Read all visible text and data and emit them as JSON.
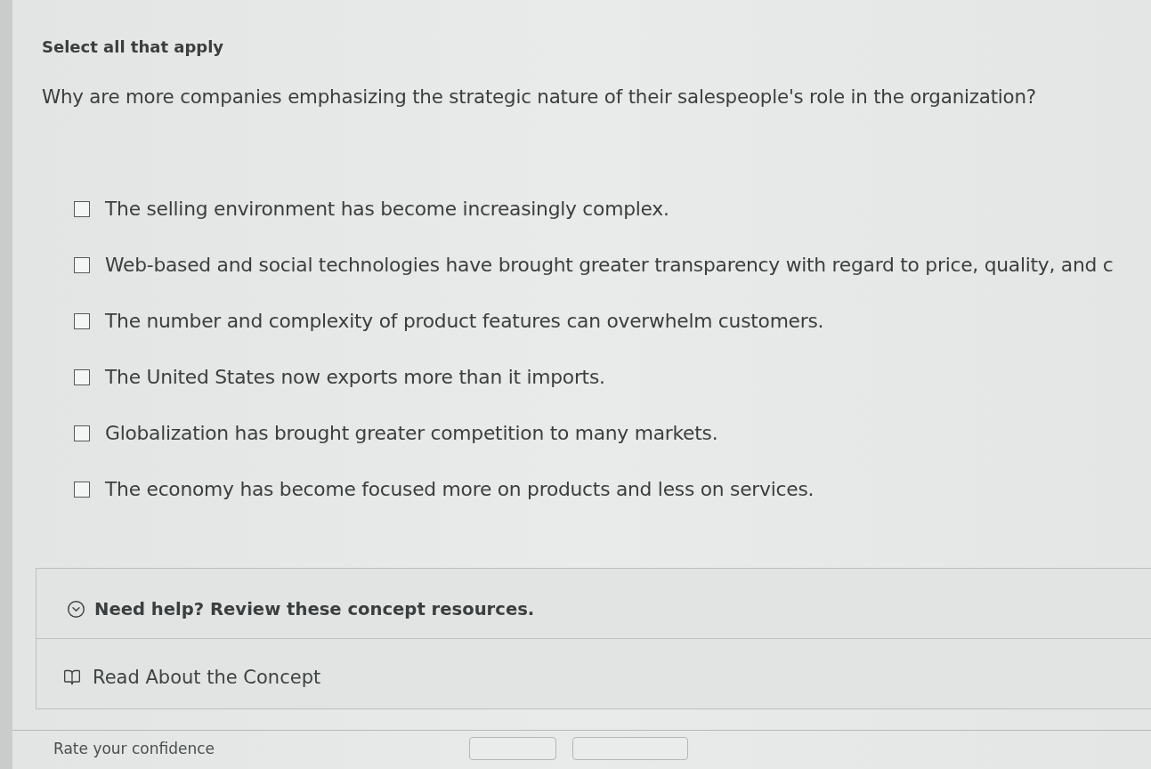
{
  "instruction": "Select all that apply",
  "question": "Why are more companies emphasizing the strategic nature of their salespeople's role in the organization?",
  "options": [
    {
      "label": "The selling environment has become increasingly complex.",
      "checked": false
    },
    {
      "label": "Web-based and social technologies have brought greater transparency with regard to price, quality, and c",
      "checked": false
    },
    {
      "label": "The number and complexity of product features can overwhelm customers.",
      "checked": false
    },
    {
      "label": "The United States now exports more than it imports.",
      "checked": false
    },
    {
      "label": "Globalization has brought greater competition to many markets.",
      "checked": false
    },
    {
      "label": "The economy has become focused more on products and less on services.",
      "checked": false
    }
  ],
  "help": {
    "title": "Need help? Review these concept resources.",
    "expanded": true,
    "resources": [
      {
        "label": "Read About the Concept"
      }
    ]
  },
  "confidence": {
    "label": "Rate your confidence"
  }
}
